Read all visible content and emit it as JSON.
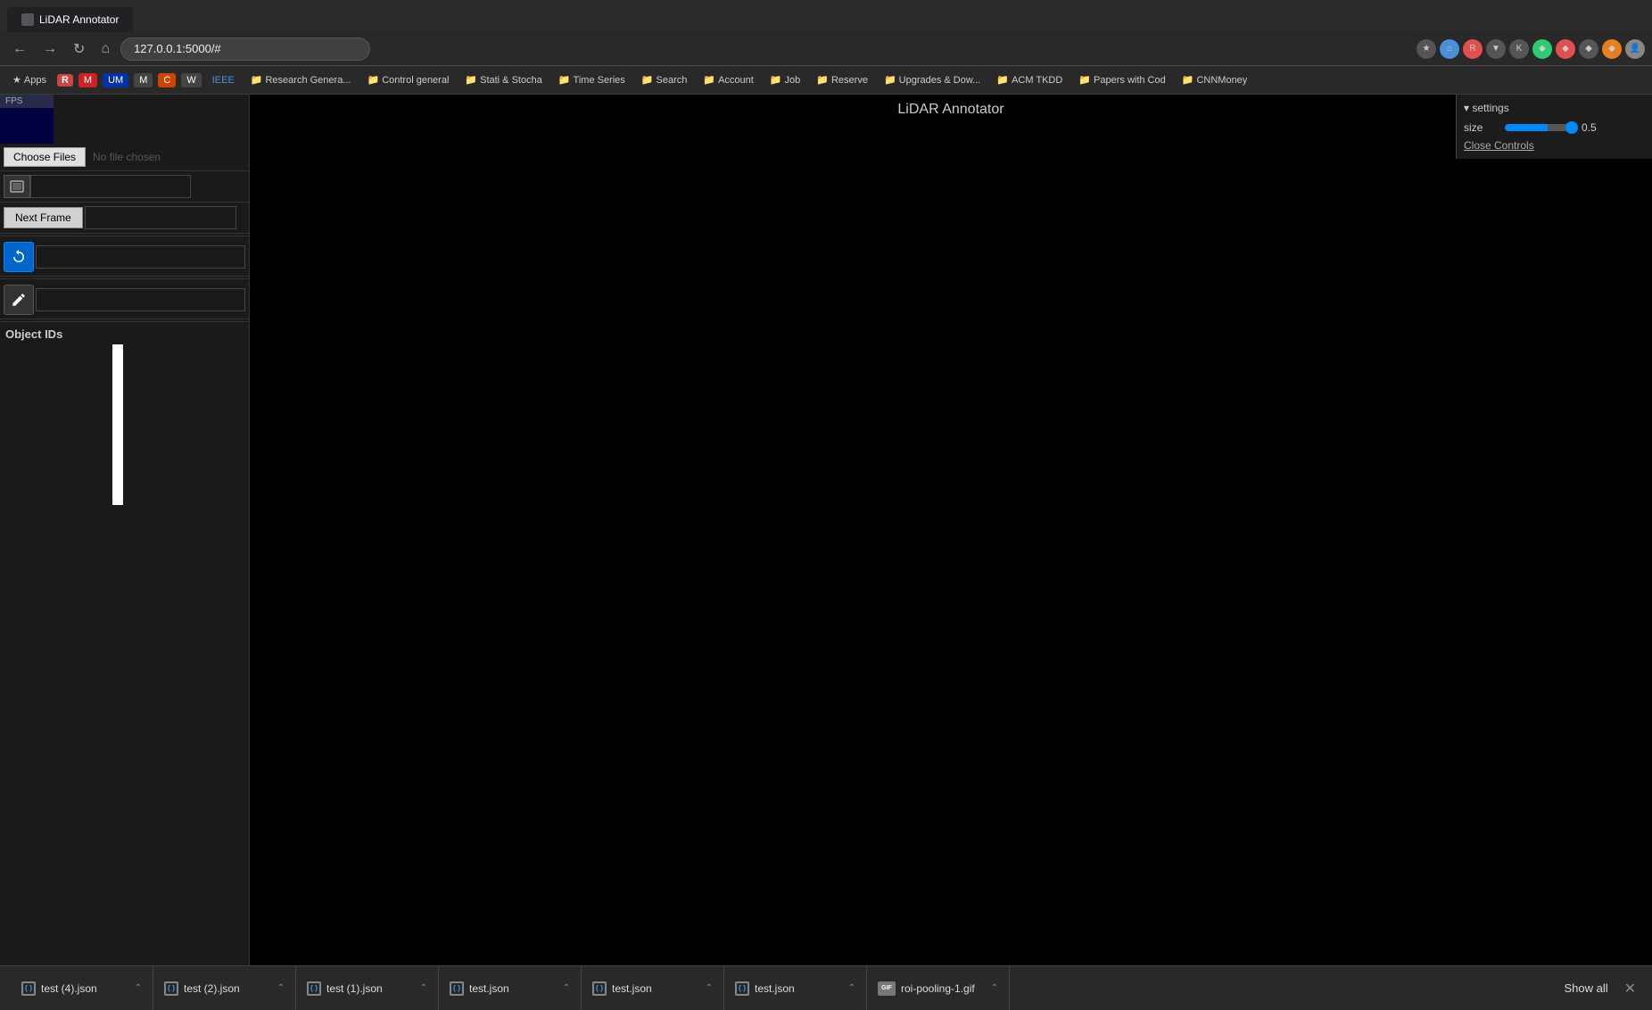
{
  "browser": {
    "tab_title": "LiDAR Annotator",
    "address": "127.0.0.1:5000/#",
    "fps_label": "FPS"
  },
  "bookmarks": [
    {
      "label": "Apps",
      "type": "text"
    },
    {
      "label": "R",
      "type": "icon"
    },
    {
      "label": "M",
      "type": "icon"
    },
    {
      "label": "UM",
      "type": "icon"
    },
    {
      "label": "M",
      "type": "icon"
    },
    {
      "label": "C",
      "type": "icon"
    },
    {
      "label": "W",
      "type": "icon"
    },
    {
      "label": "IEEE",
      "type": "text"
    },
    {
      "label": "Research Genera...",
      "type": "folder"
    },
    {
      "label": "Control general",
      "type": "folder"
    },
    {
      "label": "Stati & Stocha",
      "type": "folder"
    },
    {
      "label": "Time Series",
      "type": "folder"
    },
    {
      "label": "Search",
      "type": "folder"
    },
    {
      "label": "Account",
      "type": "folder"
    },
    {
      "label": "Job",
      "type": "folder"
    },
    {
      "label": "Reserve",
      "type": "folder"
    },
    {
      "label": "Upgrades & Dow...",
      "type": "folder"
    },
    {
      "label": "ACM TKDD",
      "type": "folder"
    },
    {
      "label": "Papers with Cod",
      "type": "folder"
    },
    {
      "label": "CNNMoney",
      "type": "folder"
    }
  ],
  "app": {
    "title": "LiDAR Annotator"
  },
  "left_panel": {
    "choose_files_label": "Choose Files",
    "no_file_label": "No file chosen",
    "next_frame_label": "Next Frame",
    "object_ids_label": "Object IDs"
  },
  "settings": {
    "title": "▾ settings",
    "size_label": "size",
    "size_value": "0.5",
    "close_controls_label": "Close Controls"
  },
  "downloads": [
    {
      "filename": "test (4).json",
      "icon_type": "json"
    },
    {
      "filename": "test (2).json",
      "icon_type": "json"
    },
    {
      "filename": "test (1).json",
      "icon_type": "json"
    },
    {
      "filename": "test.json",
      "icon_type": "json"
    },
    {
      "filename": "test.json",
      "icon_type": "json"
    },
    {
      "filename": "test.json",
      "icon_type": "json"
    },
    {
      "filename": "roi-pooling-1.gif",
      "icon_type": "gif"
    }
  ],
  "show_all_label": "Show all"
}
